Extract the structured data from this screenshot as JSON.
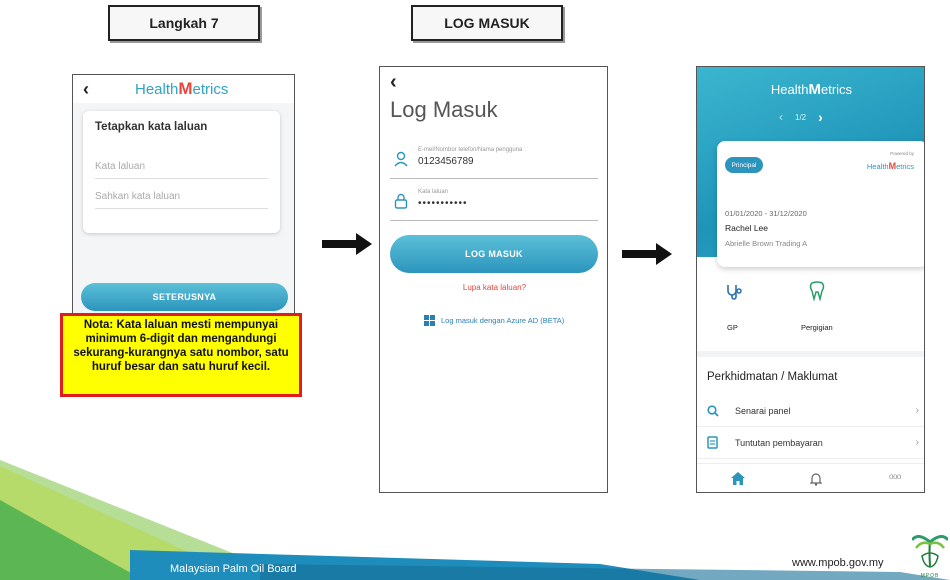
{
  "step_label": "Langkah 7",
  "login_label": "LOG MASUK",
  "phone1": {
    "brand_pre": "Health",
    "brand_m": "M",
    "brand_post": "etrics",
    "back": "‹",
    "heading": "Tetapkan kata laluan",
    "field1_placeholder": "Kata laluan",
    "field2_placeholder": "Sahkan kata laluan",
    "next_button": "SETERUSNYA"
  },
  "note": "Nota: Kata laluan mesti mempunyai minimum 6-digit dan mengandungi sekurang-kurangnya satu nombor, satu huruf besar dan satu huruf kecil.",
  "phone2": {
    "back": "‹",
    "title": "Log Masuk",
    "user_label": "E-mel/Nombor telefon/Nama pengguna",
    "user_value": "0123456789",
    "pass_label": "Kata laluan",
    "pass_value": "•••••••••••",
    "login_button": "LOG MASUK",
    "forgot": "Lupa kata laluan?",
    "azure": "Log masuk dengan Azure AD (BETA)"
  },
  "phone3": {
    "brand_pre": "Health",
    "brand_m": "M",
    "brand_post": "etrics",
    "pager": "1/2",
    "badge": "Principal",
    "powered": "Powered by",
    "card_brand_pre": "Health",
    "card_brand_m": "M",
    "card_brand_post": "etrics",
    "dates": "01/01/2020 - 31/12/2020",
    "name": "Rachel Lee",
    "company": "Abrielle Brown Trading A",
    "svc1": "GP",
    "svc2": "Pergigian",
    "section_title": "Perkhidmatan / Maklumat",
    "row1": "Senarai panel",
    "row2": "Tuntutan pembayaran",
    "more": "ooo"
  },
  "footer": {
    "org": "Malaysian Palm Oil Board",
    "url": "www.mpob.gov.my",
    "logo_text": "MPOB"
  },
  "colors": {
    "teal": "#2c95bd",
    "red_logo": "#e8453c",
    "note_bg": "#ffff00",
    "note_border": "#e21b1b"
  }
}
